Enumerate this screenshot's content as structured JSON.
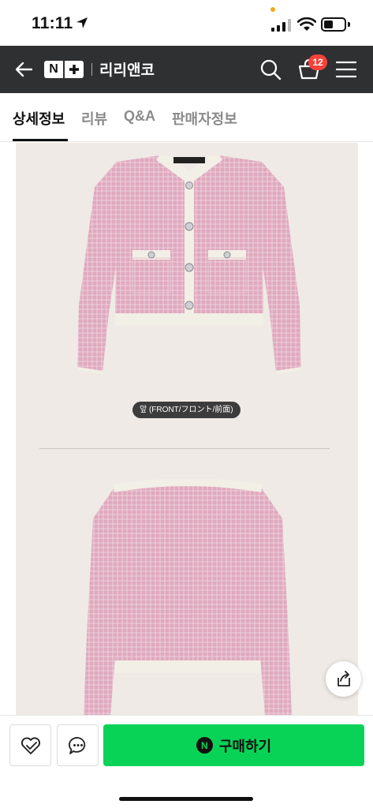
{
  "status_bar": {
    "time": "11:11",
    "icons": [
      "location-arrow-icon",
      "signal-icon",
      "wifi-icon",
      "battery-icon"
    ],
    "battery_level": 0.45
  },
  "header": {
    "logo_n": "N",
    "store_name": "리리앤코",
    "cart_count": "12",
    "colors": {
      "background": "#2e3032",
      "badge": "#f5433a"
    },
    "icons": [
      "back-arrow-icon",
      "search-icon",
      "cart-icon",
      "hamburger-menu-icon"
    ]
  },
  "tabs": [
    {
      "label": "상세정보",
      "active": true
    },
    {
      "label": "리뷰",
      "active": false
    },
    {
      "label": "Q&A",
      "active": false
    },
    {
      "label": "판매자정보",
      "active": false
    }
  ],
  "content": {
    "front_caption": "앞 (FRONT/フロント/前面)",
    "colors": {
      "panel": "#efeae5",
      "jacket": "#dfa9be",
      "trim": "#f2efe6"
    }
  },
  "bottom_bar": {
    "buy_label": "구매하기",
    "buy_logo": "N",
    "colors": {
      "buy": "#08d357"
    },
    "icons": [
      "heart-check-icon",
      "chat-bubble-icon",
      "share-icon"
    ]
  }
}
